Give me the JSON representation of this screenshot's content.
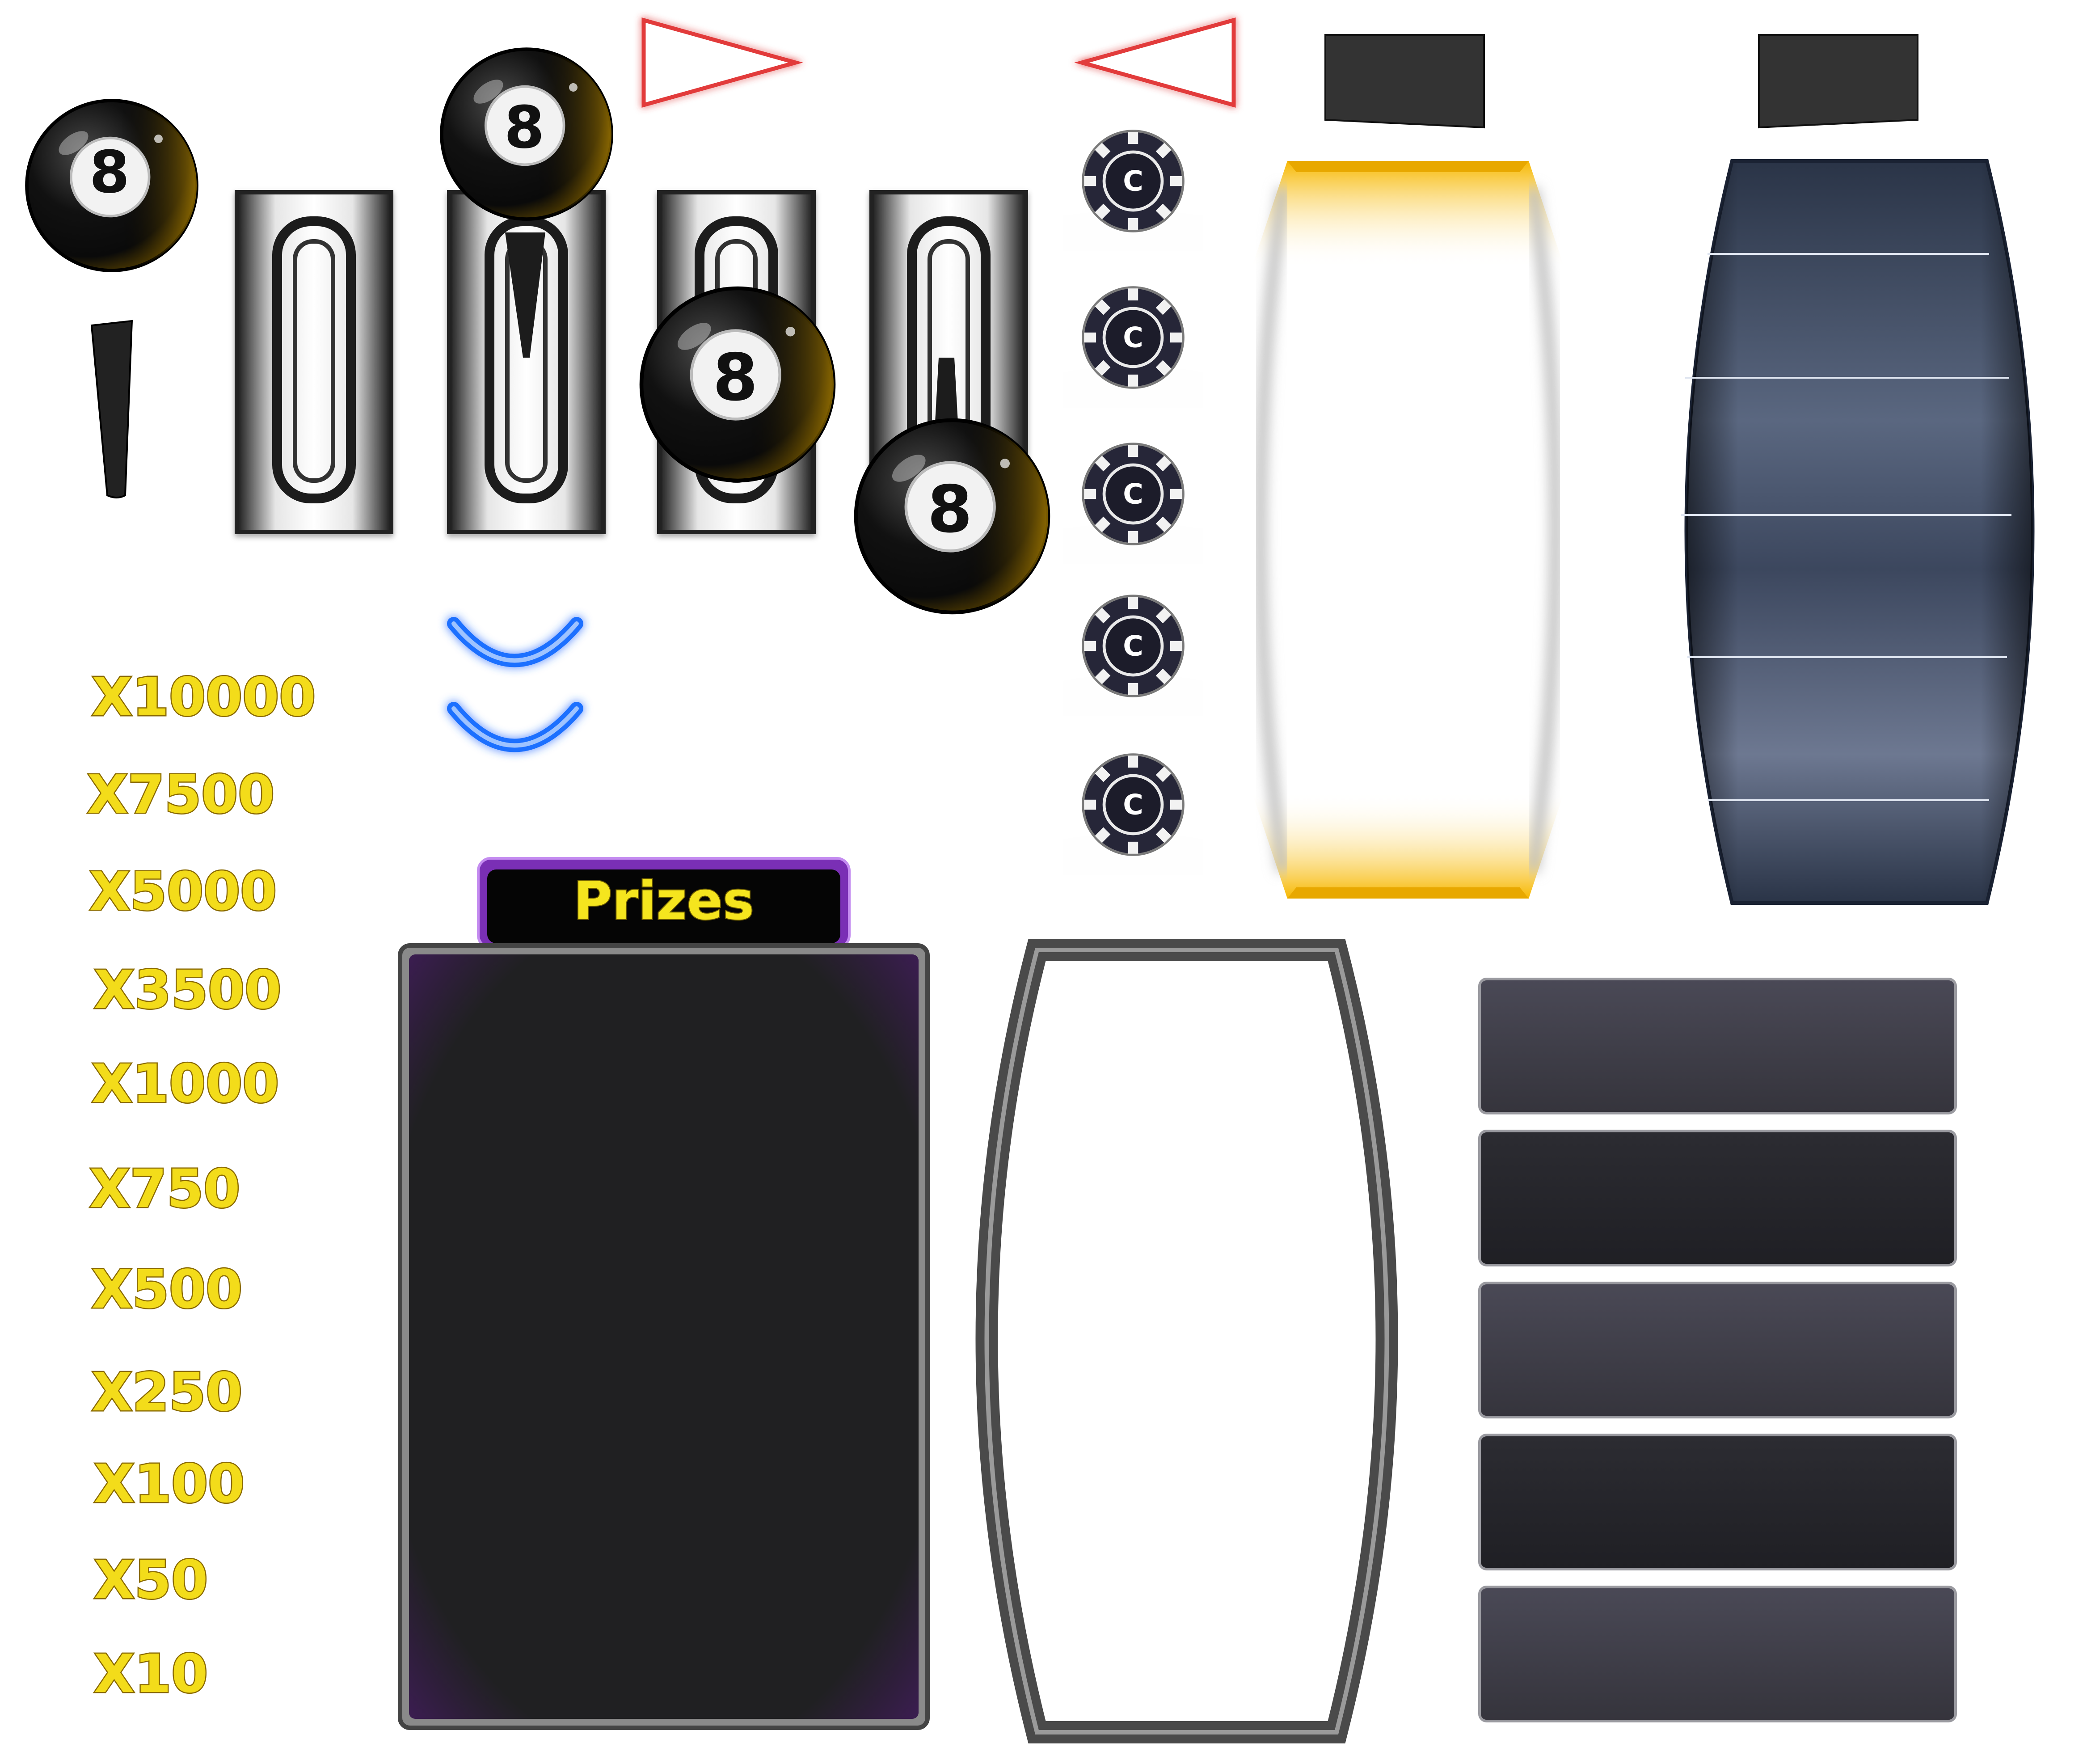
{
  "ball": {
    "number": "8"
  },
  "chip": {
    "letter": "C"
  },
  "prizes_panel": {
    "title": "Prizes"
  },
  "multipliers": [
    "X10000",
    "X7500",
    "X5000",
    "X3500",
    "X1000",
    "X750",
    "X500",
    "X250",
    "X100",
    "X50",
    "X10"
  ],
  "colors": {
    "gold_text": "#f3dc1a",
    "gold_outline": "#8a6a00",
    "chevron_blue": "#1e6fff",
    "triangle_red": "#e23a3a",
    "tube_gold": "#f7b800",
    "prizes_purple": "#7a2fb5",
    "panel_dark": "#202022",
    "row_light": "#3d3c45",
    "row_dark": "#26262b",
    "barrel_navy": "#3a4660"
  }
}
